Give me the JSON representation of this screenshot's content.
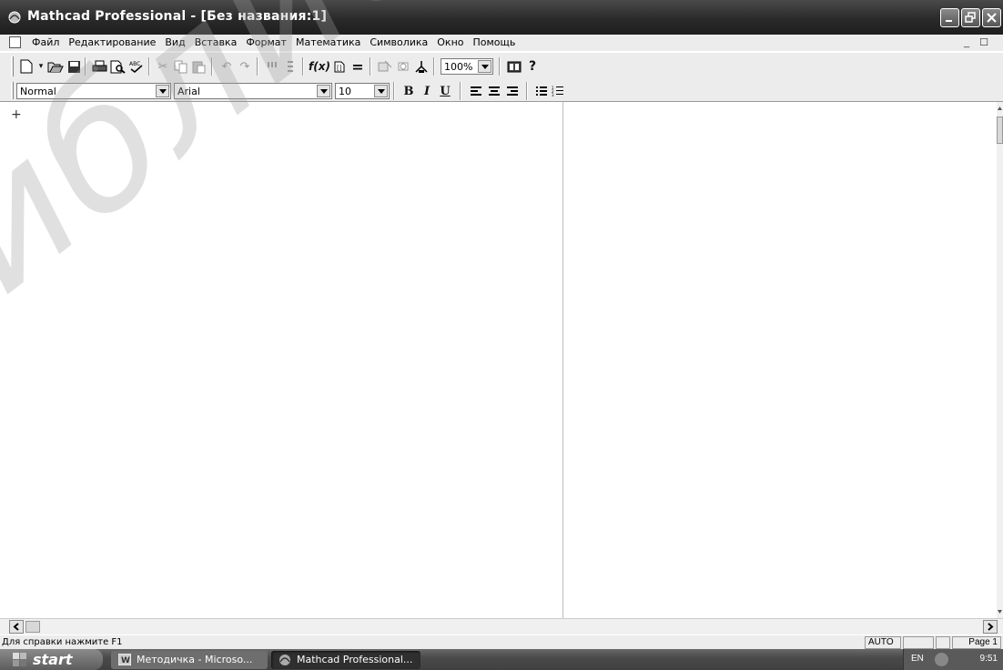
{
  "window": {
    "title": "Mathcad Professional - [Без названия:1]"
  },
  "menubar": {
    "items": [
      "Файл",
      "Редактирование",
      "Вид",
      "Вставка",
      "Формат",
      "Математика",
      "Символика",
      "Окно",
      "Помощь"
    ],
    "mdi_controls": "_ ☐"
  },
  "toolbar": {
    "zoom": "100%"
  },
  "format_toolbar": {
    "style": "Normal",
    "font": "Arial",
    "size": "10",
    "bold": "B",
    "italic": "I",
    "underline": "U"
  },
  "worksheet": {
    "cursor": "+"
  },
  "statusbar": {
    "help_text": "Для справки нажмите F1",
    "mode": "AUTO",
    "page": "Page 1"
  },
  "taskbar": {
    "start_label": "start",
    "tasks": [
      "Методичка - Microso...",
      "Mathcad Professional..."
    ],
    "language": "EN",
    "clock": "9:51"
  },
  "watermark": {
    "text": "Библиотека БГУИР"
  },
  "colors": {
    "titlebar": "#2a2a2a",
    "toolbar_bg": "#ececec",
    "taskbar": "#4a4a4a"
  }
}
